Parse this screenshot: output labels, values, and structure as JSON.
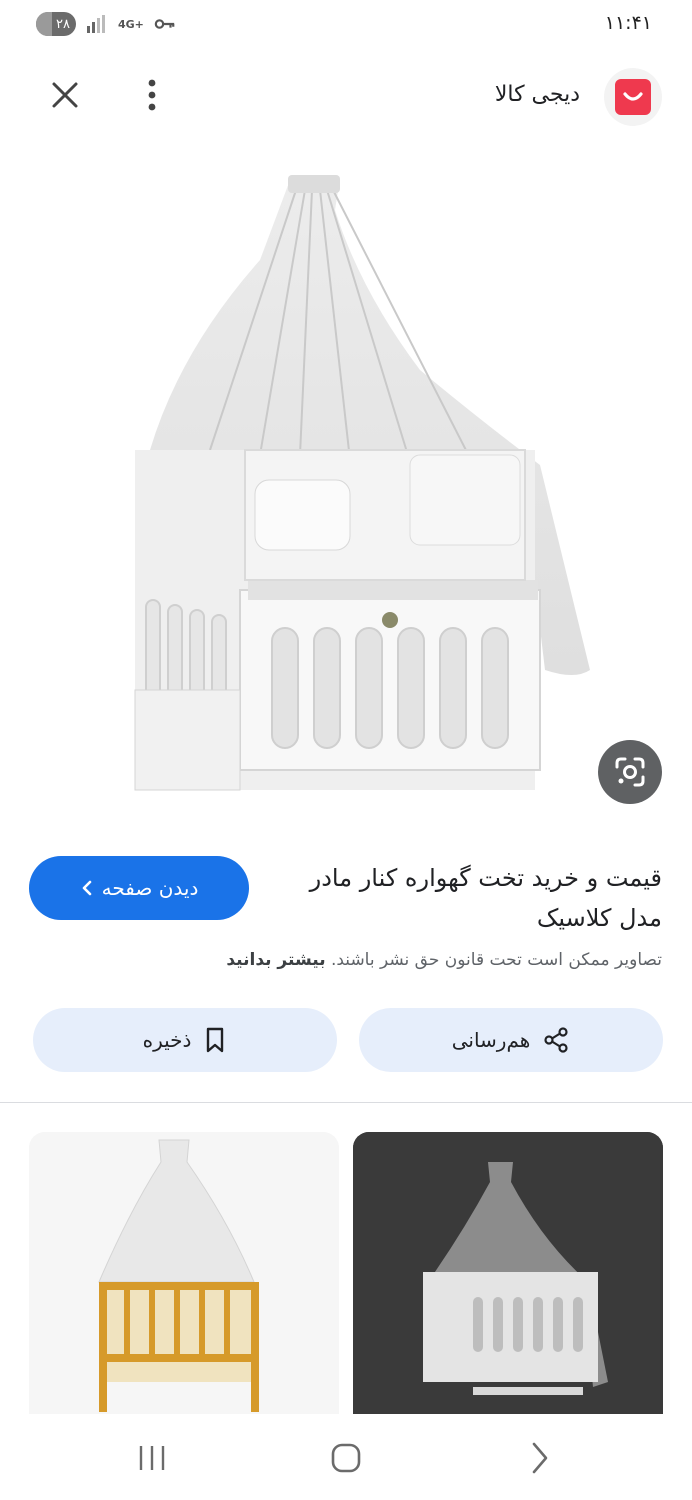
{
  "status_bar": {
    "time": "۱۱:۴۱",
    "battery": "۲۸",
    "network": "4G+"
  },
  "header": {
    "site_name": "دیجی کالا",
    "logo_icon": "digikala-logo-icon",
    "brand_color": "#ef394e"
  },
  "result": {
    "title": "قیمت و خرید تخت گهواره کنار مادر مدل کلاسیک",
    "visit_label": "دیدن صفحه",
    "copyright_text": "تصاویر ممکن است تحت قانون حق نشر باشند.",
    "learn_more": "بیشتر بدانید"
  },
  "actions": {
    "share_label": "هم‌رسانی",
    "save_label": "ذخیره"
  },
  "colors": {
    "accent": "#1a73e8",
    "pill_bg": "#e6eefb"
  }
}
